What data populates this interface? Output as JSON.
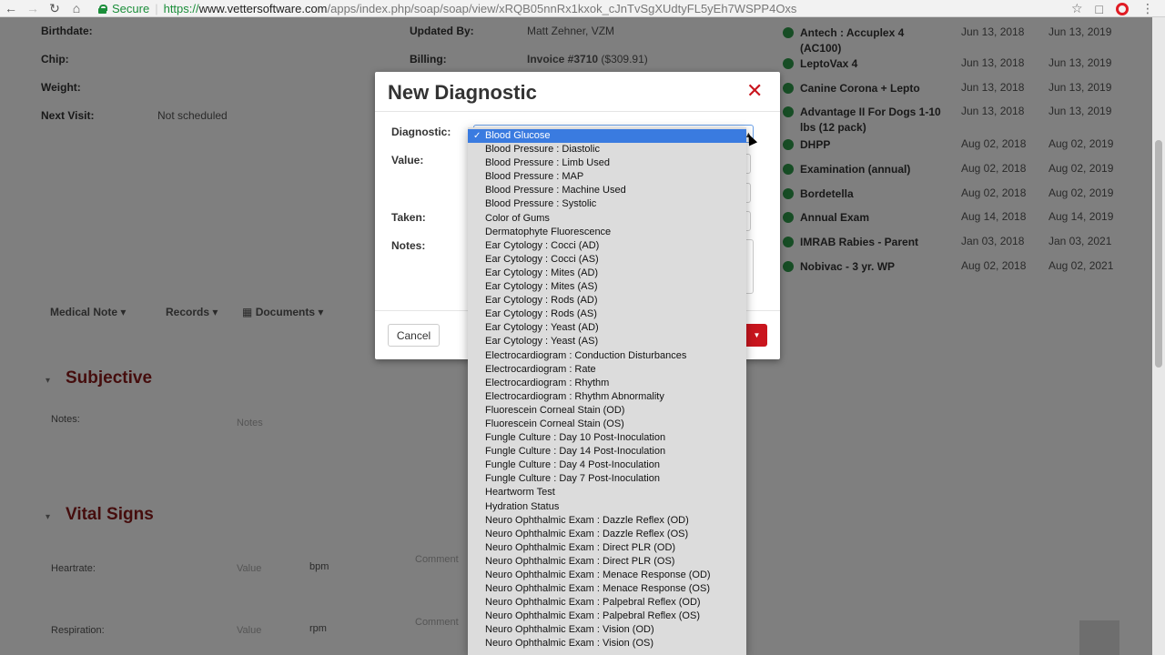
{
  "browser": {
    "secure_label": "Secure",
    "url_scheme": "https://",
    "url_host": "www.vettersoftware.com",
    "url_path": "/apps/index.php/soap/soap/view/xRQB05nnRx1kxok_cJnTvSgXUdtyFL5yEh7WSPP4Oxs"
  },
  "patient": {
    "birthdate_label": "Birthdate:",
    "chip_label": "Chip:",
    "weight_label": "Weight:",
    "next_visit_label": "Next Visit:",
    "next_visit_value": "Not scheduled",
    "updated_by_label": "Updated By:",
    "updated_by_value": "Matt Zehner, VZM",
    "billing_label": "Billing:",
    "billing_invoice": "Invoice #3710",
    "billing_amount": "($309.91)"
  },
  "vaccines": [
    {
      "name": "Antech : Accuplex 4 (AC100)",
      "date1": "Jun 13, 2018",
      "date2": "Jun 13, 2019"
    },
    {
      "name": "LeptoVax 4",
      "date1": "Jun 13, 2018",
      "date2": "Jun 13, 2019"
    },
    {
      "name": "Canine Corona + Lepto",
      "date1": "Jun 13, 2018",
      "date2": "Jun 13, 2019"
    },
    {
      "name": "Advantage II For Dogs 1-10 lbs (12 pack)",
      "date1": "Jun 13, 2018",
      "date2": "Jun 13, 2019"
    },
    {
      "name": "DHPP",
      "date1": "Aug 02, 2018",
      "date2": "Aug 02, 2019"
    },
    {
      "name": "Examination (annual)",
      "date1": "Aug 02, 2018",
      "date2": "Aug 02, 2019"
    },
    {
      "name": "Bordetella",
      "date1": "Aug 02, 2018",
      "date2": "Aug 02, 2019"
    },
    {
      "name": "Annual Exam",
      "date1": "Aug 14, 2018",
      "date2": "Aug 14, 2019"
    },
    {
      "name": "IMRAB Rabies - Parent",
      "date1": "Jan 03, 2018",
      "date2": "Jan 03, 2021"
    },
    {
      "name": "Nobivac - 3 yr. WP",
      "date1": "Aug 02, 2018",
      "date2": "Aug 02, 2021"
    }
  ],
  "tabs": [
    {
      "label": "Medical Note"
    },
    {
      "label": "Records"
    },
    {
      "label": "Documents"
    }
  ],
  "sections": {
    "subjective": "Subjective",
    "subjective_notes_label": "Notes:",
    "subjective_notes_placeholder": "Notes",
    "vital_signs": "Vital Signs",
    "heartrate_label": "Heartrate:",
    "heartrate_placeholder": "Value",
    "heartrate_unit": "bpm",
    "respiration_label": "Respiration:",
    "respiration_placeholder": "Value",
    "respiration_unit": "rpm",
    "comment_placeholder": "Comment"
  },
  "modal": {
    "title": "New Diagnostic",
    "diagnostic_label": "Diagnostic:",
    "value_label": "Value:",
    "taken_label": "Taken:",
    "notes_label": "Notes:",
    "cancel_label": "Cancel",
    "selected_option": "Blood Glucose",
    "options": [
      "Blood Glucose",
      "Blood Pressure : Diastolic",
      "Blood Pressure : Limb Used",
      "Blood Pressure : MAP",
      "Blood Pressure : Machine Used",
      "Blood Pressure : Systolic",
      "Color of Gums",
      "Dermatophyte Fluorescence",
      "Ear Cytology : Cocci (AD)",
      "Ear Cytology : Cocci (AS)",
      "Ear Cytology : Mites (AD)",
      "Ear Cytology : Mites (AS)",
      "Ear Cytology : Rods (AD)",
      "Ear Cytology : Rods (AS)",
      "Ear Cytology : Yeast (AD)",
      "Ear Cytology : Yeast (AS)",
      "Electrocardiogram : Conduction Disturbances",
      "Electrocardiogram : Rate",
      "Electrocardiogram : Rhythm",
      "Electrocardiogram : Rhythm Abnormality",
      "Fluorescein Corneal Stain (OD)",
      "Fluorescein Corneal Stain (OS)",
      "Fungle Culture : Day 10 Post-Inoculation",
      "Fungle Culture : Day 14 Post-Inoculation",
      "Fungle Culture : Day 4 Post-Inoculation",
      "Fungle Culture : Day 7 Post-Inoculation",
      "Heartworm Test",
      "Hydration Status",
      "Neuro Ophthalmic Exam : Dazzle Reflex (OD)",
      "Neuro Ophthalmic Exam : Dazzle Reflex (OS)",
      "Neuro Ophthalmic Exam : Direct PLR (OD)",
      "Neuro Ophthalmic Exam : Direct PLR (OS)",
      "Neuro Ophthalmic Exam : Menace Response (OD)",
      "Neuro Ophthalmic Exam : Menace Response (OS)",
      "Neuro Ophthalmic Exam : Palpebral Reflex (OD)",
      "Neuro Ophthalmic Exam : Palpebral Reflex (OS)",
      "Neuro Ophthalmic Exam : Vision (OD)",
      "Neuro Ophthalmic Exam : Vision (OS)"
    ]
  },
  "colors": {
    "accent_red": "#c9151e",
    "section_red": "#8b1a1a",
    "selected_blue": "#3a7be0",
    "secure_green": "#1b8e3a"
  },
  "icons": {
    "back": "arrow-left-icon",
    "forward": "arrow-right-icon",
    "reload": "reload-icon",
    "home": "home-icon",
    "bookmark": "star-icon",
    "close": "close-icon"
  }
}
